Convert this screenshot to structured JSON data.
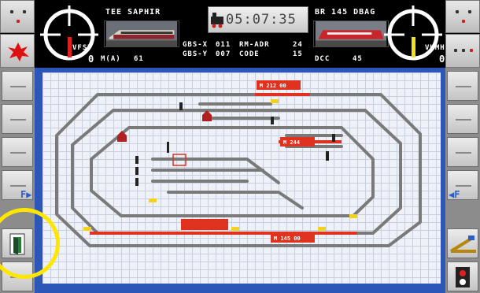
{
  "header": {
    "left_train_name": "TEE SAPHIR",
    "right_train_name": "BR 145 DBAG",
    "clock": "05:07:35",
    "left_gauge_label": "VFST",
    "right_gauge_label": "VKMH",
    "left_speed_value": "0",
    "right_speed_value": "0",
    "left_mode": "M(A)",
    "left_address": "61",
    "gbs_x_label": "GBS-X",
    "gbs_x_value": "011",
    "gbs_y_label": "GBS-Y",
    "gbs_y_value": "007",
    "rm_adr_label": "RM-ADR",
    "rm_adr_value": "24",
    "code_label": "CODE",
    "code_value": "15",
    "right_protocol": "DCC",
    "right_address": "45"
  },
  "track_labels": {
    "top_route": "M 212 00",
    "middle_route": "M 244",
    "bottom_route": "M 145 00"
  },
  "icons": {
    "left_sidebar_arrow": "F▶",
    "right_sidebar_arrow": "◀F"
  },
  "colors": {
    "panel_blue": "#2c56b8",
    "track_gray": "#7a7a7a",
    "occupied_red": "#e0331f",
    "highlight_yellow": "#ffe600",
    "grid_bg": "#eef1f7"
  }
}
